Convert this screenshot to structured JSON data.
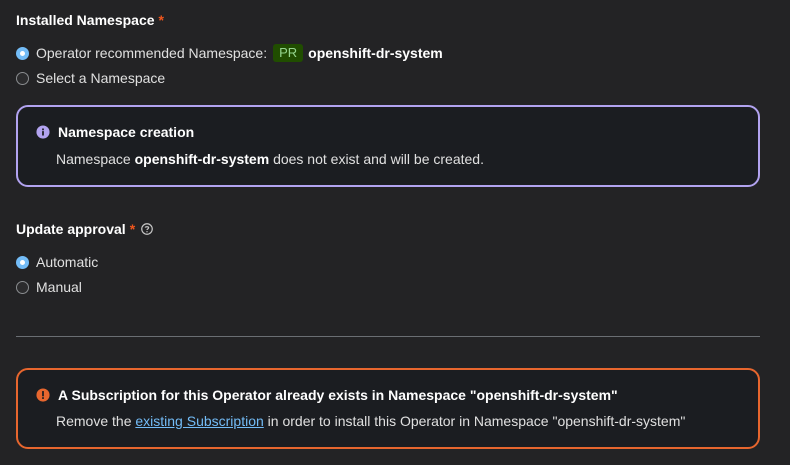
{
  "installed_namespace": {
    "label": "Installed Namespace",
    "required_mark": "*",
    "options": {
      "recommended": {
        "label": "Operator recommended Namespace:",
        "badge": "PR",
        "namespace": "openshift-dr-system",
        "checked": true
      },
      "select": {
        "label": "Select a Namespace",
        "checked": false
      }
    }
  },
  "info_alert": {
    "title": "Namespace creation",
    "body_prefix": "Namespace",
    "body_namespace": "openshift-dr-system",
    "body_suffix": "does not exist and will be created.",
    "icon": "info-circle-icon"
  },
  "update_approval": {
    "label": "Update approval",
    "required_mark": "*",
    "help_icon": "question-circle-icon",
    "options": {
      "automatic": {
        "label": "Automatic",
        "checked": true
      },
      "manual": {
        "label": "Manual",
        "checked": false
      }
    }
  },
  "danger_alert": {
    "title": "A Subscription for this Operator already exists in Namespace \"openshift-dr-system\"",
    "body_prefix": "Remove the",
    "link_text": "existing Subscription",
    "body_suffix": "in order to install this Operator in Namespace \"openshift-dr-system\"",
    "icon": "exclamation-circle-icon"
  },
  "colors": {
    "background": "#232325",
    "info_border": "#b2a3f0",
    "danger_border": "#e7662e",
    "link": "#73bcf7",
    "required": "#f0561d"
  }
}
